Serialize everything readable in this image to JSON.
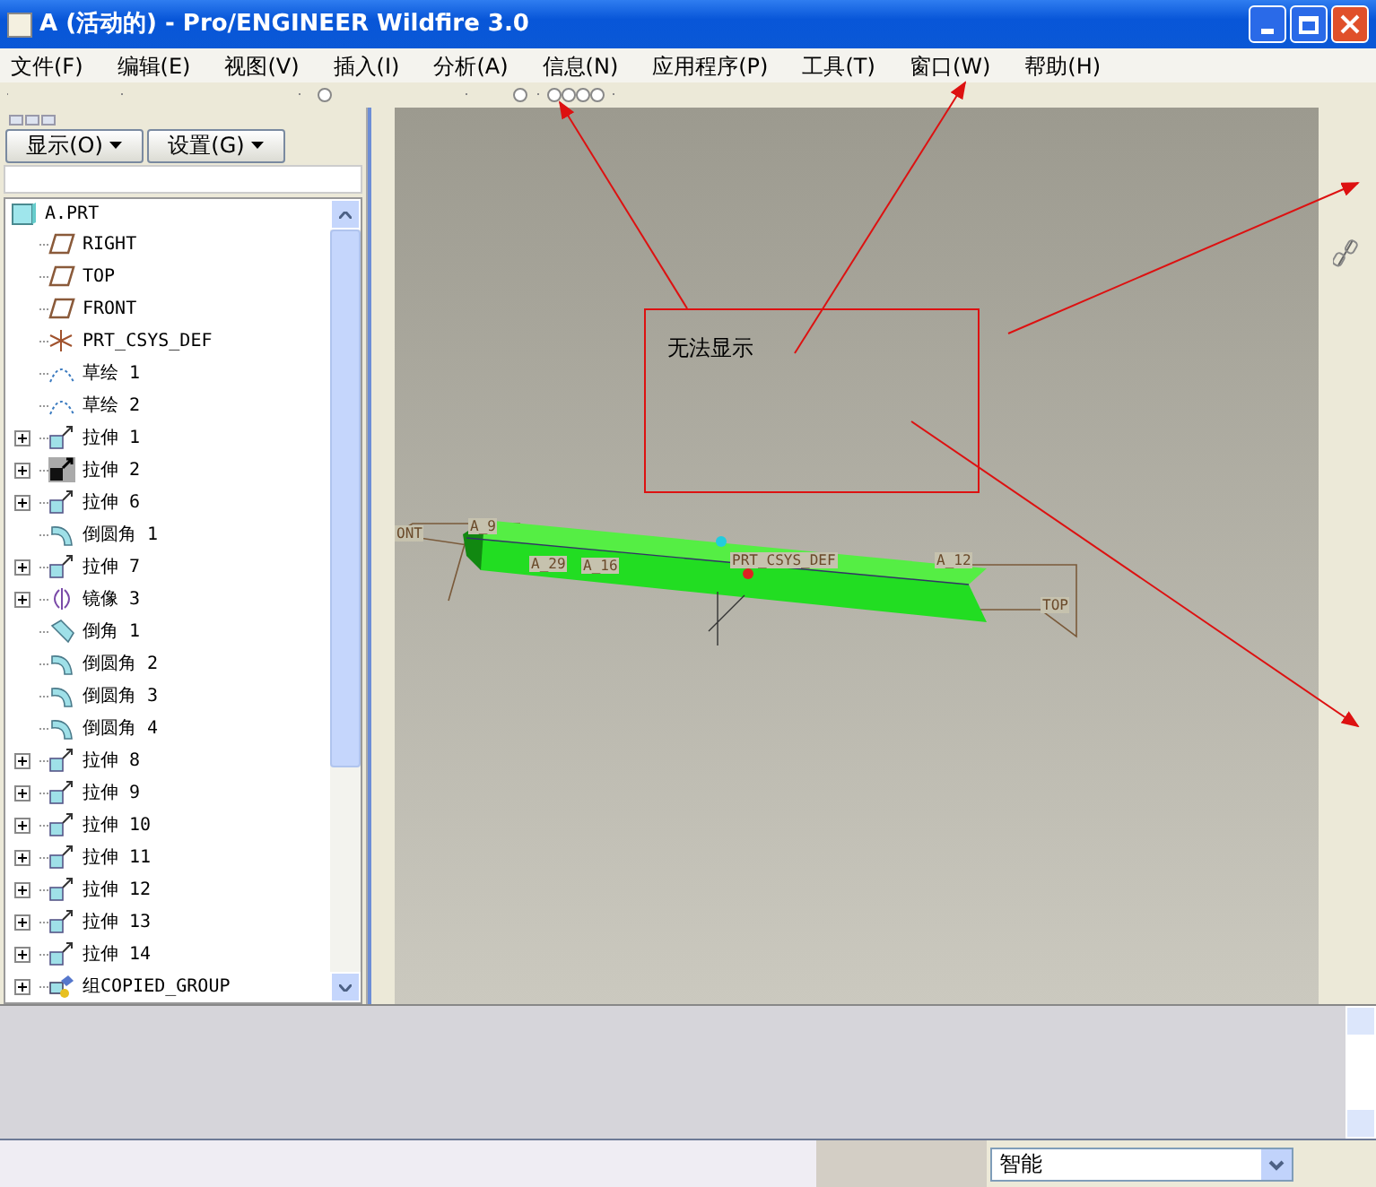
{
  "window": {
    "title": "A (活动的) - Pro/ENGINEER Wildfire 3.0"
  },
  "menu": [
    "文件(F)",
    "编辑(E)",
    "视图(V)",
    "插入(I)",
    "分析(A)",
    "信息(N)",
    "应用程序(P)",
    "工具(T)",
    "窗口(W)",
    "帮助(H)"
  ],
  "model_tree": {
    "buttons": [
      "显示(O)",
      "设置(G)"
    ],
    "root": {
      "label": "A.PRT",
      "kind": "part",
      "children": [
        {
          "label": "RIGHT",
          "kind": "plane",
          "expandable": false
        },
        {
          "label": "TOP",
          "kind": "plane",
          "expandable": false
        },
        {
          "label": "FRONT",
          "kind": "plane",
          "expandable": false
        },
        {
          "label": "PRT_CSYS_DEF",
          "kind": "csys",
          "expandable": false
        },
        {
          "label": "草绘 1",
          "kind": "sketch",
          "expandable": false
        },
        {
          "label": "草绘 2",
          "kind": "sketch",
          "expandable": false
        },
        {
          "label": "拉伸 1",
          "kind": "extrude",
          "expandable": true
        },
        {
          "label": "拉伸 2",
          "kind": "extrude_dark",
          "expandable": true
        },
        {
          "label": "拉伸 6",
          "kind": "extrude",
          "expandable": true
        },
        {
          "label": "倒圆角 1",
          "kind": "round",
          "expandable": false
        },
        {
          "label": "拉伸 7",
          "kind": "extrude",
          "expandable": true
        },
        {
          "label": "镜像 3",
          "kind": "mirror",
          "expandable": true
        },
        {
          "label": "倒角 1",
          "kind": "chamfer",
          "expandable": false
        },
        {
          "label": "倒圆角 2",
          "kind": "round",
          "expandable": false
        },
        {
          "label": "倒圆角 3",
          "kind": "round",
          "expandable": false
        },
        {
          "label": "倒圆角 4",
          "kind": "round",
          "expandable": false
        },
        {
          "label": "拉伸 8",
          "kind": "extrude",
          "expandable": true
        },
        {
          "label": "拉伸 9",
          "kind": "extrude",
          "expandable": true
        },
        {
          "label": "拉伸 10",
          "kind": "extrude",
          "expandable": true
        },
        {
          "label": "拉伸 11",
          "kind": "extrude",
          "expandable": true
        },
        {
          "label": "拉伸 12",
          "kind": "extrude",
          "expandable": true
        },
        {
          "label": "拉伸 13",
          "kind": "extrude",
          "expandable": true
        },
        {
          "label": "拉伸 14",
          "kind": "extrude",
          "expandable": true
        },
        {
          "label": "组COPIED_GROUP",
          "kind": "group",
          "expandable": true
        }
      ]
    }
  },
  "graphics": {
    "labels": [
      "ONT",
      "A_9",
      "A_29",
      "A_16",
      "PRT_CSYS_DEF",
      "A_12",
      "TOP"
    ],
    "note": "无法显示"
  },
  "status_bar": {
    "filter": "智能"
  }
}
